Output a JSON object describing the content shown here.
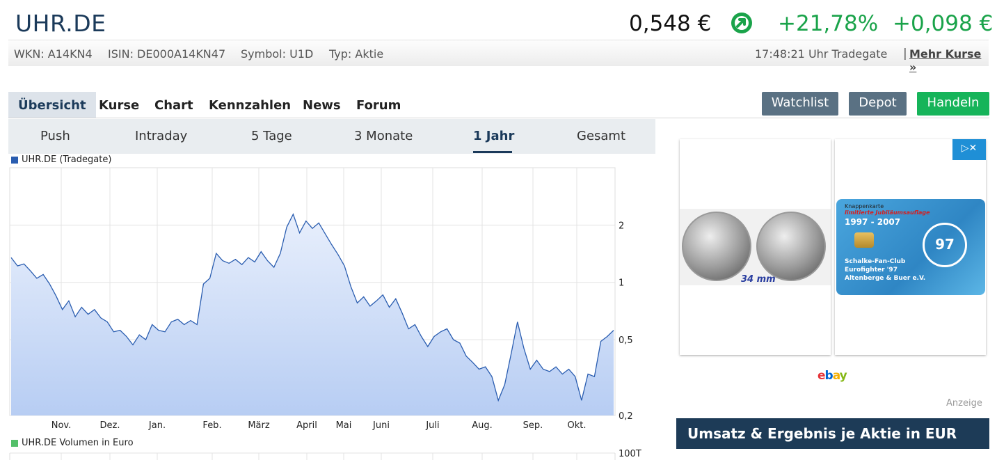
{
  "header": {
    "ticker": "UHR.DE",
    "price": "0,548 €",
    "change_pct": "+21,78%",
    "change_abs": "+0,098 €",
    "up_color": "#1aa34a"
  },
  "info": {
    "wkn": "WKN: A14KN4",
    "isin": "ISIN: DE000A14KN47",
    "symbol": "Symbol: U1D",
    "typ": "Typ: Aktie",
    "time": "17:48:21 Uhr Tradegate",
    "separator": "|",
    "mehr_kurse": "Mehr Kurse »"
  },
  "nav": {
    "tabs": [
      "Übersicht",
      "Kurse",
      "Chart",
      "Kennzahlen",
      "News",
      "Forum"
    ],
    "active": "Übersicht",
    "buttons": {
      "watchlist": "Watchlist",
      "depot": "Depot",
      "handeln": "Handeln"
    }
  },
  "range_tabs": {
    "items": [
      "Push",
      "Intraday",
      "5 Tage",
      "3 Monate",
      "1 Jahr",
      "Gesamt"
    ],
    "active": "1 Jahr"
  },
  "chart_data": {
    "type": "area",
    "series": [
      {
        "name": "UHR.DE (Tradegate)",
        "color": "#2a5db0",
        "values": [
          1.35,
          1.22,
          1.25,
          1.15,
          1.05,
          1.1,
          0.98,
          0.85,
          0.72,
          0.8,
          0.66,
          0.74,
          0.68,
          0.72,
          0.65,
          0.62,
          0.55,
          0.56,
          0.52,
          0.47,
          0.53,
          0.5,
          0.6,
          0.56,
          0.55,
          0.62,
          0.64,
          0.6,
          0.63,
          0.6,
          0.98,
          1.05,
          1.42,
          1.3,
          1.26,
          1.32,
          1.24,
          1.35,
          1.28,
          1.45,
          1.3,
          1.2,
          1.42,
          1.95,
          2.28,
          1.82,
          2.1,
          1.92,
          2.05,
          1.8,
          1.58,
          1.4,
          1.22,
          0.95,
          0.78,
          0.84,
          0.75,
          0.8,
          0.86,
          0.74,
          0.82,
          0.69,
          0.57,
          0.6,
          0.52,
          0.46,
          0.52,
          0.55,
          0.57,
          0.5,
          0.48,
          0.41,
          0.38,
          0.35,
          0.36,
          0.32,
          0.24,
          0.29,
          0.42,
          0.62,
          0.45,
          0.35,
          0.39,
          0.35,
          0.34,
          0.36,
          0.33,
          0.35,
          0.32,
          0.24,
          0.33,
          0.32,
          0.49,
          0.52,
          0.56
        ]
      },
      {
        "name": "UHR.DE Volumen in Euro",
        "color": "#54c06a",
        "values": []
      }
    ],
    "x_labels": [
      "Nov.",
      "Dez.",
      "Jan.",
      "Feb.",
      "März",
      "April",
      "Mai",
      "Juni",
      "Juli",
      "Aug.",
      "Sep.",
      "Okt."
    ],
    "y_ticks": [
      {
        "value": 0.2,
        "label": "0,2"
      },
      {
        "value": 0.5,
        "label": "0,5"
      },
      {
        "value": 1,
        "label": "1"
      },
      {
        "value": 2,
        "label": "2"
      }
    ],
    "volume_tick": "100T",
    "ylim": [
      0.2,
      4.0
    ],
    "y_scale": "log",
    "grid": true,
    "legend": "top-left"
  },
  "ad": {
    "coin_caption": "34 mm",
    "card_line1": "Knappenkarte",
    "card_line2": "limitierte Jubiläumsauflage",
    "card_years": "1997 - 2007",
    "card_seal": "97",
    "card_club": [
      "Schalke-Fan-Club",
      "Eurofighter '97",
      "Altenberge & Buer e.V."
    ],
    "brand": "ebay",
    "label": "Anzeige"
  },
  "section": {
    "umsatz_title": "Umsatz & Ergebnis je Aktie in EUR"
  }
}
